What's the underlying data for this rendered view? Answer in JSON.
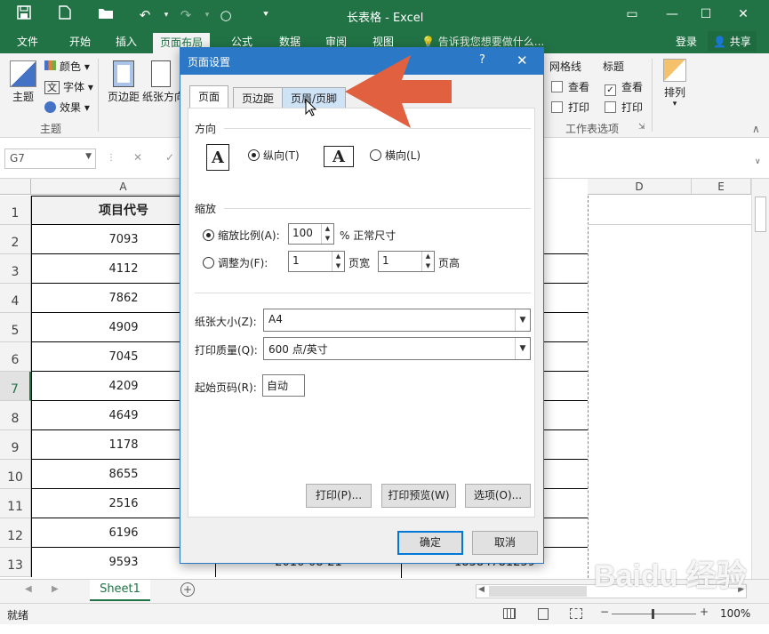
{
  "window": {
    "title": "长表格 - Excel"
  },
  "ribbon_tabs": [
    "文件",
    "开始",
    "插入",
    "页面布局",
    "公式",
    "数据",
    "审阅",
    "视图"
  ],
  "tell_me": "告诉我您想要做什么...",
  "account": {
    "login": "登录",
    "share": "共享"
  },
  "ribbon": {
    "theme_label": "主题",
    "colors": "颜色",
    "fonts": "字体",
    "effects": "效果",
    "group_theme": "主题",
    "margins": "页边距",
    "orientation": "纸张方向",
    "gridlines": "网格线",
    "headings": "标题",
    "view": "查看",
    "print": "打印",
    "group_sheet_options": "工作表选项",
    "arrange": "排列"
  },
  "namebox": "G7",
  "columns": [
    "A",
    "D",
    "E"
  ],
  "rows": [
    {
      "num": "1",
      "a": "项目代号"
    },
    {
      "num": "2",
      "a": "7093"
    },
    {
      "num": "3",
      "a": "4112"
    },
    {
      "num": "4",
      "a": "7862"
    },
    {
      "num": "5",
      "a": "4909"
    },
    {
      "num": "6",
      "a": "7045"
    },
    {
      "num": "7",
      "a": "4209"
    },
    {
      "num": "8",
      "a": "4649"
    },
    {
      "num": "9",
      "a": "1178"
    },
    {
      "num": "10",
      "a": "8655"
    },
    {
      "num": "11",
      "a": "2516"
    },
    {
      "num": "12",
      "a": "6196"
    },
    {
      "num": "13",
      "a": "9593"
    }
  ],
  "row13_partial": {
    "b": "2016-08-21",
    "c": "18384781259"
  },
  "sheet_tab": "Sheet1",
  "status": {
    "ready": "就绪",
    "zoom": "100%"
  },
  "dialog": {
    "title": "页面设置",
    "help": "?",
    "tabs": [
      "页面",
      "页边距",
      "页眉/页脚"
    ],
    "orientation_label": "方向",
    "portrait": "纵向(T)",
    "landscape": "横向(L)",
    "scaling_label": "缩放",
    "adjust_to": "缩放比例(A):",
    "adjust_value": "100",
    "normal_size": "% 正常尺寸",
    "fit_to": "调整为(F):",
    "fit_wide": "1",
    "pages_wide": "页宽",
    "fit_tall": "1",
    "pages_tall": "页高",
    "paper_size_label": "纸张大小(Z):",
    "paper_size": "A4",
    "print_quality_label": "打印质量(Q):",
    "print_quality": "600 点/英寸",
    "first_page_label": "起始页码(R):",
    "first_page": "自动",
    "btn_print": "打印(P)...",
    "btn_preview": "打印预览(W)",
    "btn_options": "选项(O)...",
    "btn_ok": "确定",
    "btn_cancel": "取消"
  },
  "colors": {
    "excel_green": "#217346",
    "dialog_blue": "#2b78c6",
    "arrow": "#e0603f"
  }
}
